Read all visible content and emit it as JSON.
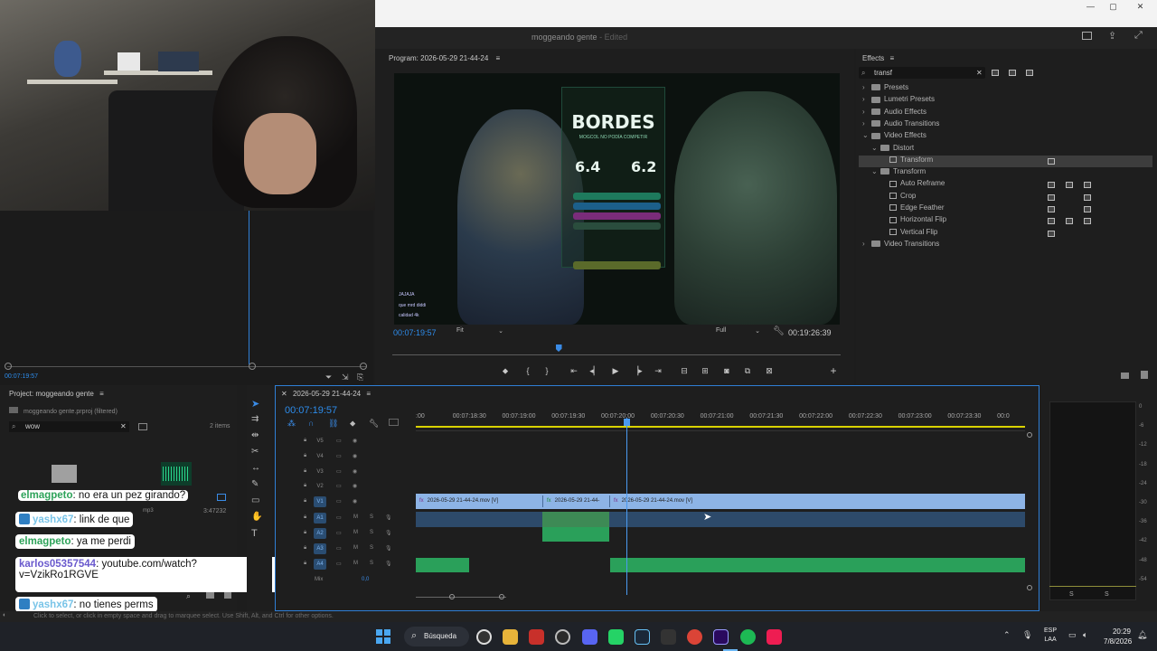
{
  "app": {
    "document_title": "moggeando gente",
    "edited_label": "- Edited"
  },
  "window_controls": [
    "—",
    "▢",
    "✕"
  ],
  "program_monitor": {
    "title": "Program: 2026-05-29 21-44-24",
    "timecode": "00:07:19:57",
    "fit": "Fit",
    "quality": "Full",
    "duration": "00:19:26:39",
    "playhead_fraction": 0.37
  },
  "video_frame": {
    "title": "BORDES",
    "subtitle": "MOGCOL NO PODÍA COMPETIR",
    "score_left": "6.4",
    "score_right": "6.2",
    "chat_lines": [
      "JAJAJA",
      "que mrd diddi",
      "calidad 4k"
    ]
  },
  "effects": {
    "title": "Effects",
    "search_value": "transf",
    "tree": [
      {
        "label": "Presets",
        "type": "folder",
        "level": 0
      },
      {
        "label": "Lumetri Presets",
        "type": "folder",
        "level": 0
      },
      {
        "label": "Audio Effects",
        "type": "folder",
        "level": 0
      },
      {
        "label": "Audio Transitions",
        "type": "folder",
        "level": 0
      },
      {
        "label": "Video Effects",
        "type": "folder",
        "level": 0,
        "expanded": true
      },
      {
        "label": "Distort",
        "type": "folder",
        "level": 1,
        "expanded": true
      },
      {
        "label": "Transform",
        "type": "effect",
        "level": 2,
        "selected": true
      },
      {
        "label": "Transform",
        "type": "folder",
        "level": 1,
        "expanded": true
      },
      {
        "label": "Auto Reframe",
        "type": "effect",
        "level": 2
      },
      {
        "label": "Crop",
        "type": "effect",
        "level": 2
      },
      {
        "label": "Edge Feather",
        "type": "effect",
        "level": 2
      },
      {
        "label": "Horizontal Flip",
        "type": "effect",
        "level": 2
      },
      {
        "label": "Vertical Flip",
        "type": "effect",
        "level": 2
      },
      {
        "label": "Video Transitions",
        "type": "folder",
        "level": 0
      }
    ]
  },
  "source": {
    "timecode": "00:07:19:57"
  },
  "project": {
    "title": "Project: moggeando gente",
    "file": "moggeando gente.prproj (filtered)",
    "search_value": "wow",
    "items_count": "2 items",
    "item_duration": "3:47232",
    "item_ext": "mp3"
  },
  "timeline": {
    "sequence_name": "2026-05-29 21-44-24",
    "timecode": "00:07:19:57",
    "ruler": [
      ":00",
      "00:07:18:30",
      "00:07:19:00",
      "00:07:19:30",
      "00:07:20:00",
      "00:07:20:30",
      "00:07:21:00",
      "00:07:21:30",
      "00:07:22:00",
      "00:07:22:30",
      "00:07:23:00",
      "00:07:23:30",
      "00:0"
    ],
    "video_tracks": [
      "V5",
      "V4",
      "V3",
      "V2",
      "V1"
    ],
    "audio_tracks": [
      "A1",
      "A2",
      "A3",
      "A4"
    ],
    "mix_label": "Mix",
    "mix_value": "0,0",
    "clips": [
      {
        "label": "2026-05-29 21-44-24.mov [V]"
      },
      {
        "label": "2026-05-29 21-44-"
      },
      {
        "label": "2026-05-29 21-44-24.mov [V]"
      }
    ]
  },
  "meters": {
    "scale": [
      "0",
      "-6",
      "-12",
      "-18",
      "-24",
      "-30",
      "-36",
      "-42",
      "-48",
      "-54"
    ],
    "solo_labels": [
      "S",
      "S"
    ]
  },
  "chat": [
    {
      "user": "elmagpeto",
      "message": ": no era un pez girando?",
      "user_color": "#2ea35a",
      "twitch_badge": false
    },
    {
      "user": "yashx67",
      "message": ": link de que",
      "user_color": "#78c4e8",
      "twitch_badge": true
    },
    {
      "user": "elmagpeto",
      "message": ": ya me perdi",
      "user_color": "#2ea35a",
      "twitch_badge": false
    },
    {
      "user": "karlos05357544",
      "message": ": youtube.com/watch?",
      "message2": "v=VzikRo1RGVE",
      "user_color": "#6a5acd",
      "twitch_badge": false
    },
    {
      "user": "yashx67",
      "message": ": no tienes perms",
      "user_color": "#78c4e8",
      "twitch_badge": true
    }
  ],
  "statusbar": {
    "text": "Click to select, or click in empty space and drag to marquee select. Use Shift, Alt, and Ctrl for other options."
  },
  "taskbar": {
    "search_label": "Búsqueda",
    "lang_top": "ESP",
    "lang_bottom": "LAA",
    "time": "20:29",
    "date": "7/8/2026",
    "apps": [
      "chrome-icon",
      "folder-icon",
      "news-icon",
      "obs-icon",
      "discord-icon",
      "whatsapp-icon",
      "steam-icon",
      "epic-icon",
      "chrome-browser-icon",
      "premiere-icon",
      "spotify-icon",
      "tiktok-icon"
    ]
  }
}
